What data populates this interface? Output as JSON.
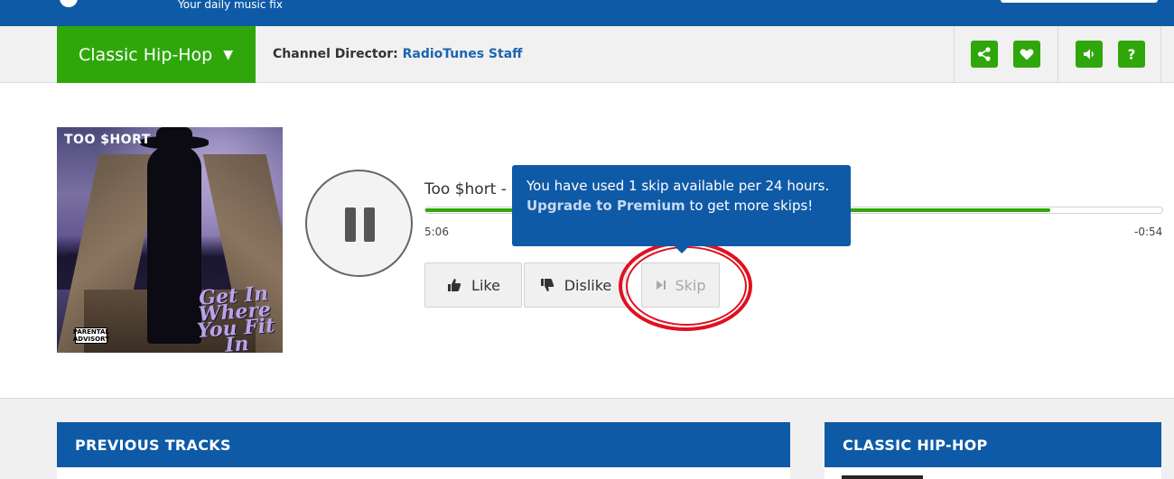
{
  "header": {
    "tagline": "Your daily music fix"
  },
  "channel_bar": {
    "channel_name": "Classic Hip-Hop",
    "dropdown_arrow": "▼",
    "director_label": "Channel Director:",
    "director_name": "RadioTunes Staff",
    "icons": [
      "share-icon",
      "heart-icon",
      "volume-icon",
      "help-icon"
    ]
  },
  "album": {
    "artist_logo": "TOO $HORT",
    "title_art": "Get In Where You Fit In",
    "advisory": "PARENTAL ADVISORY"
  },
  "player": {
    "state": "playing",
    "track_title": "Too $hort -",
    "elapsed": "5:06",
    "remaining": "-0:54",
    "progress_fraction": 0.85,
    "like_label": "Like",
    "dislike_label": "Dislike",
    "skip_label": "Skip"
  },
  "tooltip": {
    "text_before": "You have used 1 skip available per 24 hours.",
    "link_text": "Upgrade to Premium",
    "text_after": "to get more skips!"
  },
  "sections": {
    "previous_tracks": "PREVIOUS TRACKS",
    "channel_panel": "CLASSIC HIP-HOP"
  },
  "colors": {
    "brand_blue": "#0f5aa7",
    "brand_green": "#2fa70b",
    "highlight_red": "#e0101f"
  }
}
